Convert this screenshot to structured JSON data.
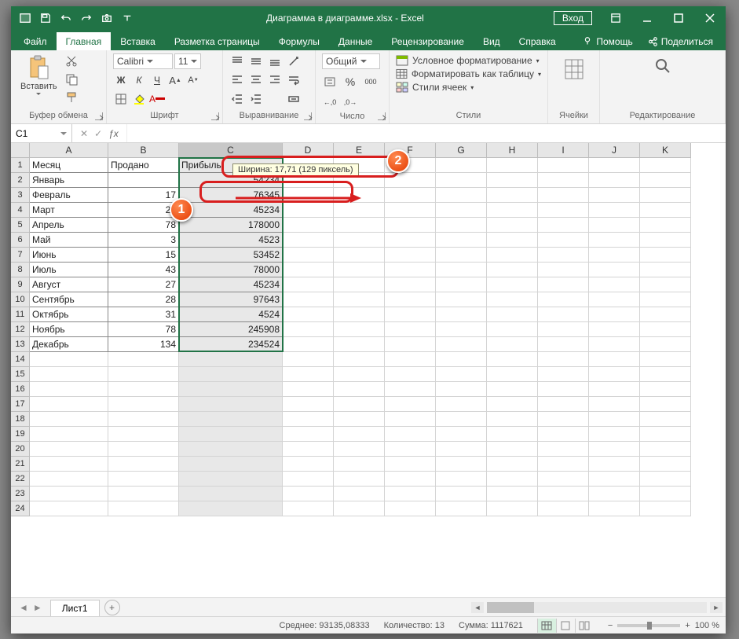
{
  "title": "Диаграмма в диаграмме.xlsx - Excel",
  "login_label": "Вход",
  "tabs": [
    "Файл",
    "Главная",
    "Вставка",
    "Разметка страницы",
    "Формулы",
    "Данные",
    "Рецензирование",
    "Вид",
    "Справка"
  ],
  "active_tab": "Главная",
  "help_label": "Помощь",
  "share_label": "Поделиться",
  "ribbon": {
    "clipboard": {
      "paste": "Вставить",
      "label": "Буфер обмена"
    },
    "font": {
      "name": "Calibri",
      "size": "11",
      "label": "Шрифт",
      "bold": "Ж",
      "italic": "К",
      "underline": "Ч"
    },
    "align": {
      "label": "Выравнивание"
    },
    "number": {
      "format": "Общий",
      "label": "Число"
    },
    "styles": {
      "cond": "Условное форматирование",
      "table": "Форматировать как таблицу",
      "cell": "Стили ячеек",
      "label": "Стили"
    },
    "cells": {
      "label": "Ячейки"
    },
    "editing": {
      "label": "Редактирование"
    }
  },
  "namebox": "C1",
  "tooltip": "Ширина: 17,71 (129 пиксель)",
  "col_headers": [
    "A",
    "B",
    "C",
    "D",
    "E",
    "F",
    "G",
    "H",
    "I",
    "J",
    "K"
  ],
  "table": {
    "headers": [
      "Месяц",
      "Продано",
      "Прибыль"
    ],
    "rows": [
      [
        "Январь",
        "",
        "54234"
      ],
      [
        "Февраль",
        "17",
        "76345"
      ],
      [
        "Март",
        "26",
        "45234"
      ],
      [
        "Апрель",
        "78",
        "178000"
      ],
      [
        "Май",
        "3",
        "4523"
      ],
      [
        "Июнь",
        "15",
        "53452"
      ],
      [
        "Июль",
        "43",
        "78000"
      ],
      [
        "Август",
        "27",
        "45234"
      ],
      [
        "Сентябрь",
        "28",
        "97643"
      ],
      [
        "Октябрь",
        "31",
        "4524"
      ],
      [
        "Ноябрь",
        "78",
        "245908"
      ],
      [
        "Декабрь",
        "134",
        "234524"
      ]
    ]
  },
  "sheet": "Лист1",
  "status": {
    "avg_label": "Среднее:",
    "avg": "93135,08333",
    "count_label": "Количество:",
    "count": "13",
    "sum_label": "Сумма:",
    "sum": "1117621",
    "zoom": "100 %"
  },
  "badges": {
    "b1": "1",
    "b2": "2"
  }
}
